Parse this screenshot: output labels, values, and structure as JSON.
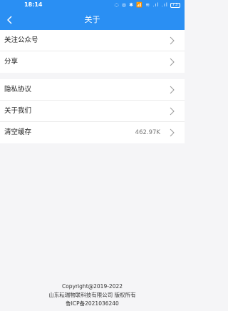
{
  "status_bar": {
    "time": "18:14",
    "icons": "◌ ◎ ✱ 📶 ≋ .ıl .ıl",
    "battery": "73"
  },
  "nav": {
    "back_icon": "chevron-left-icon",
    "title": "关于"
  },
  "group1": [
    {
      "label": "关注公众号"
    },
    {
      "label": "分享"
    }
  ],
  "group2": [
    {
      "label": "隐私协议"
    },
    {
      "label": "关于我们"
    },
    {
      "label": "清空缓存",
      "value": "462.97K"
    }
  ],
  "footer": {
    "copyright": "Copyright@2019-2022",
    "company": "山东耘瑞物联科技有限公司 版权所有",
    "icp": "鲁ICP备2021036240"
  },
  "colors": {
    "primary": "#2a8ff3",
    "background": "#f5f5f7"
  }
}
